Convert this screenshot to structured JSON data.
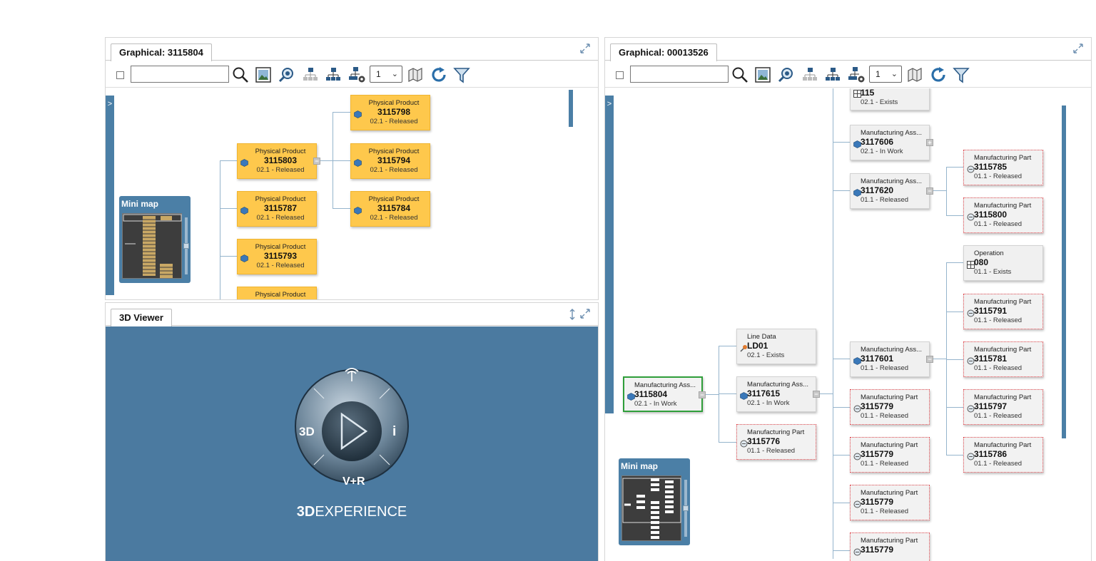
{
  "left_panel": {
    "tab_title": "Graphical: 3115804",
    "search": {
      "value": "",
      "placeholder": ""
    },
    "select_value": "1",
    "strip_arrow": ">",
    "minimap_title": "Mini map",
    "nodes": [
      {
        "type": "Physical Product",
        "id": "3115798",
        "rev": "02.1 - Released"
      },
      {
        "type": "Physical Product",
        "id": "3115803",
        "rev": "02.1 - Released"
      },
      {
        "type": "Physical Product",
        "id": "3115794",
        "rev": "02.1 - Released"
      },
      {
        "type": "Physical Product",
        "id": "3115787",
        "rev": "02.1 - Released"
      },
      {
        "type": "Physical Product",
        "id": "3115784",
        "rev": "02.1 - Released"
      },
      {
        "type": "Physical Product",
        "id": "3115793",
        "rev": "02.1 - Released"
      },
      {
        "type": "Physical Product",
        "id": "",
        "rev": ""
      }
    ]
  },
  "viewer_panel": {
    "tab_title": "3D Viewer",
    "compass": {
      "left": "3D",
      "right": "i",
      "bottom": "V+R"
    },
    "brand_bold": "3D",
    "brand_rest": "EXPERIENCE"
  },
  "right_panel": {
    "tab_title": "Graphical: 00013526",
    "search": {
      "value": "",
      "placeholder": ""
    },
    "select_value": "1",
    "strip_arrow": ">",
    "minimap_title": "Mini map",
    "nodes": [
      {
        "type": "",
        "id": "115",
        "rev": "02.1 - Exists"
      },
      {
        "type": "Manufacturing Ass...",
        "id": "3117606",
        "rev": "02.1 - In Work"
      },
      {
        "type": "Manufacturing Ass...",
        "id": "3117620",
        "rev": "01.1 - Released"
      },
      {
        "type": "Manufacturing Part",
        "id": "3115785",
        "rev": "01.1 - Released"
      },
      {
        "type": "Manufacturing Part",
        "id": "3115800",
        "rev": "01.1 - Released"
      },
      {
        "type": "Operation",
        "id": "080",
        "rev": "01.1 - Exists"
      },
      {
        "type": "Manufacturing Part",
        "id": "3115791",
        "rev": "01.1 - Released"
      },
      {
        "type": "Line Data",
        "id": "LD01",
        "rev": "02.1 - Exists"
      },
      {
        "type": "Manufacturing Ass...",
        "id": "3117601",
        "rev": "01.1 - Released"
      },
      {
        "type": "Manufacturing Part",
        "id": "3115781",
        "rev": "01.1 - Released"
      },
      {
        "type": "Manufacturing Ass...",
        "id": "3115804",
        "rev": "02.1 - In Work"
      },
      {
        "type": "Manufacturing Ass...",
        "id": "3117615",
        "rev": "02.1 - In Work"
      },
      {
        "type": "Manufacturing Part",
        "id": "3115779",
        "rev": "01.1 - Released"
      },
      {
        "type": "Manufacturing Part",
        "id": "3115797",
        "rev": "01.1 - Released"
      },
      {
        "type": "Manufacturing Part",
        "id": "3115776",
        "rev": "01.1 - Released"
      },
      {
        "type": "Manufacturing Part",
        "id": "3115779",
        "rev": "01.1 - Released"
      },
      {
        "type": "Manufacturing Part",
        "id": "3115786",
        "rev": "01.1 - Released"
      },
      {
        "type": "Manufacturing Part",
        "id": "3115779",
        "rev": "01.1 - Released"
      },
      {
        "type": "Manufacturing Part",
        "id": "3115779",
        "rev": ""
      }
    ]
  },
  "colors": {
    "accent_blue": "#4b7fa6",
    "product_yellow": "#fec84c",
    "selected_green": "#2f9e3a",
    "part_dotted_red": "#e0494f"
  },
  "icons": [
    "search-icon",
    "image-icon",
    "zoom-icon",
    "tree-collapse-icon",
    "tree-expand-icon",
    "tree-settings-icon",
    "open-3d-icon",
    "refresh-icon",
    "filter-icon",
    "expand-icon"
  ]
}
